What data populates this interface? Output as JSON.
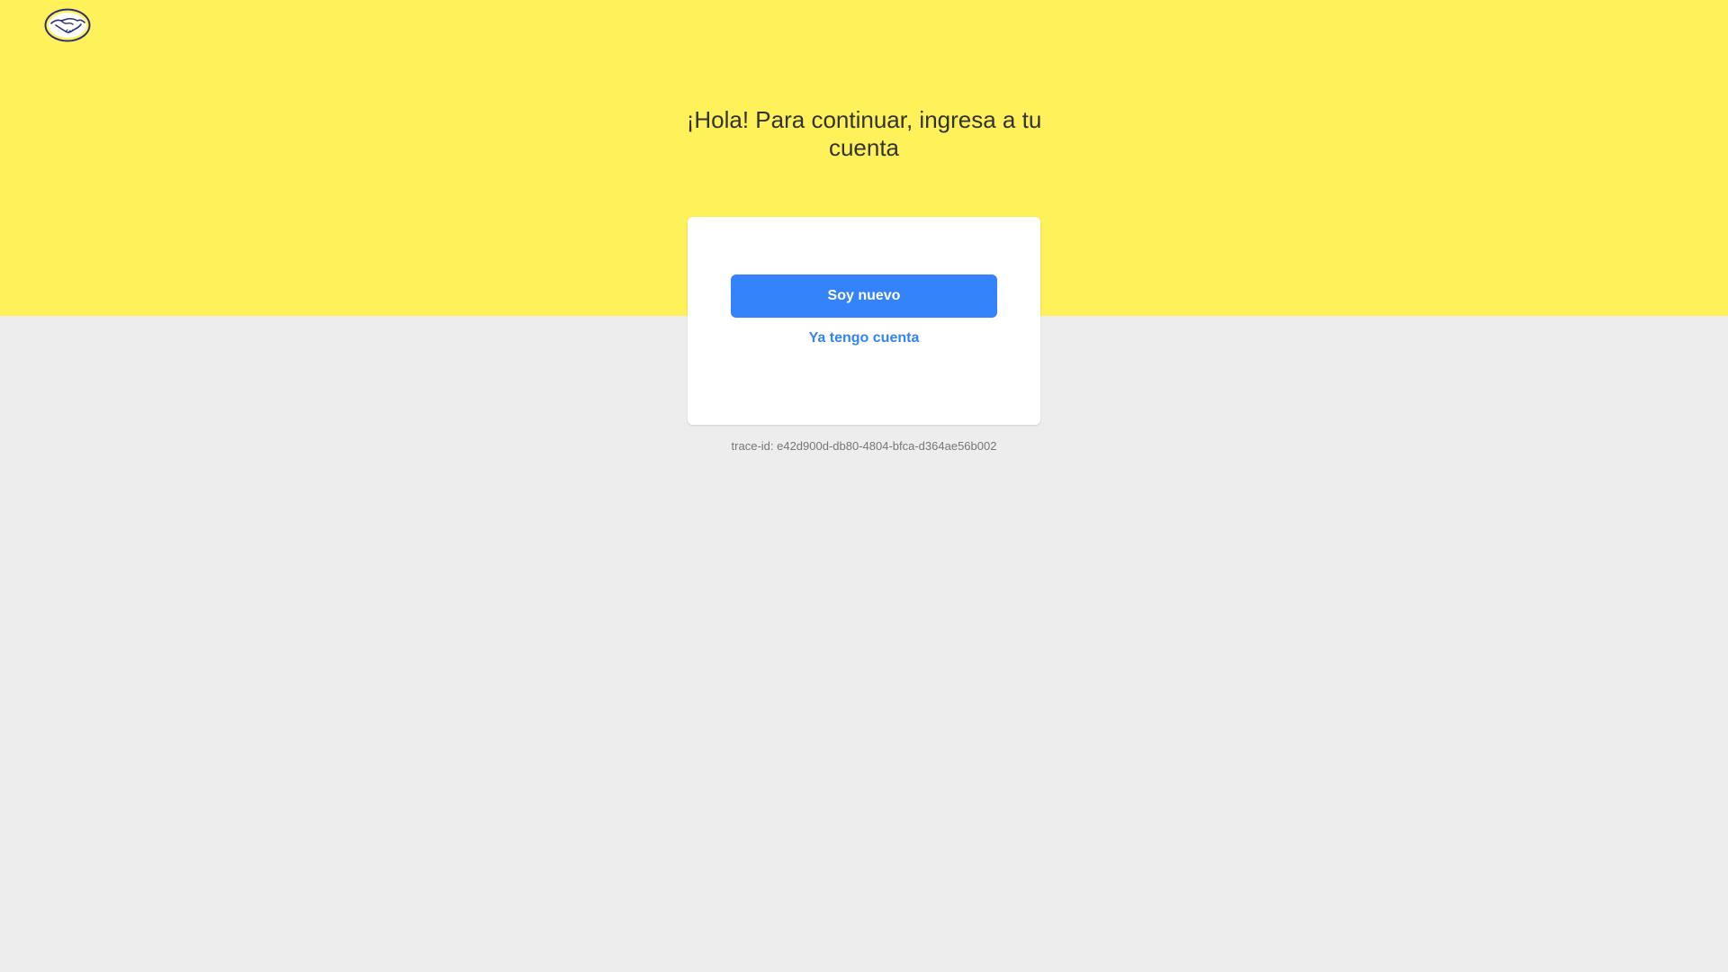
{
  "header": {
    "logo_icon": "handshake-logo-icon",
    "background_color": "#fff159"
  },
  "main": {
    "title": "¡Hola! Para continuar, ingresa a tu cuenta"
  },
  "card": {
    "primary_button_label": "Soy nuevo",
    "secondary_link_label": "Ya tengo cuenta",
    "accent_color": "#3483fa"
  },
  "footer": {
    "trace_id": "trace-id: e42d900d-db80-4804-bfca-d364ae56b002"
  }
}
